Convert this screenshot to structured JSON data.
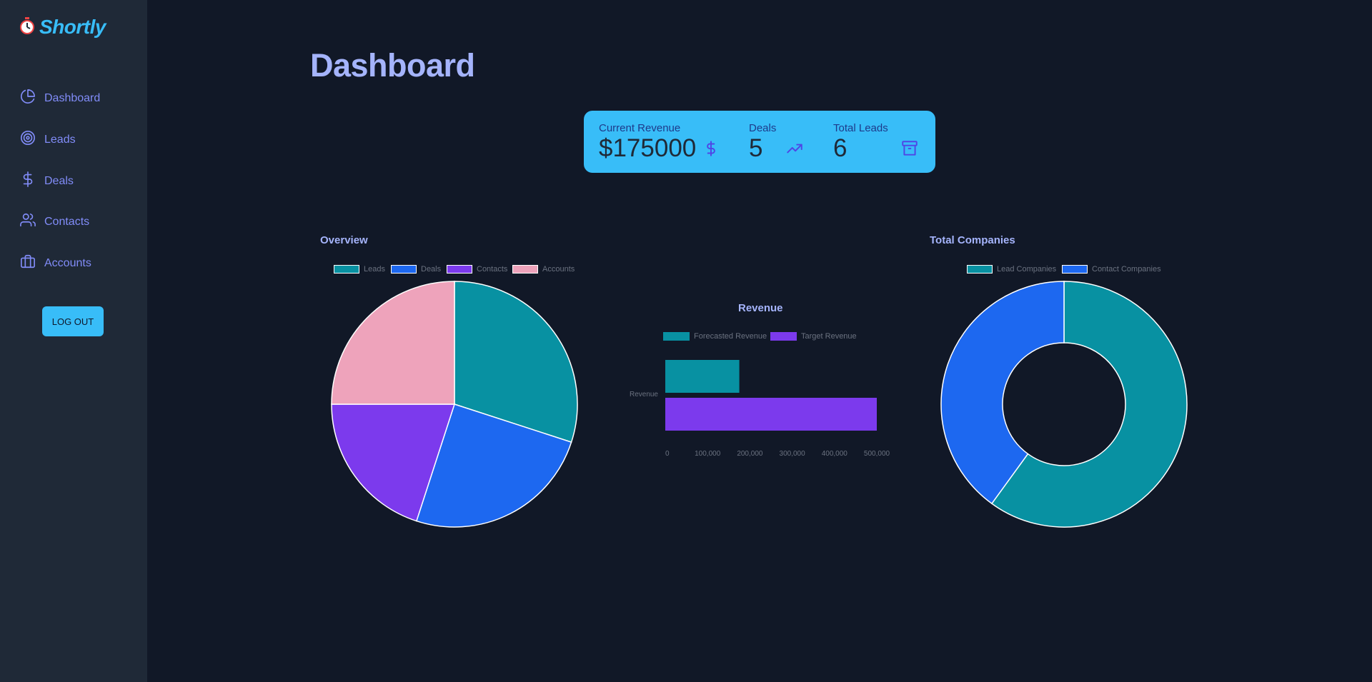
{
  "app": {
    "name": "Shortly"
  },
  "sidebar": {
    "items": [
      {
        "label": "Dashboard",
        "icon": "pie-chart-icon"
      },
      {
        "label": "Leads",
        "icon": "target-icon"
      },
      {
        "label": "Deals",
        "icon": "dollar-icon"
      },
      {
        "label": "Contacts",
        "icon": "users-icon"
      },
      {
        "label": "Accounts",
        "icon": "briefcase-icon"
      }
    ],
    "logout_label": "LOG OUT"
  },
  "page": {
    "title": "Dashboard"
  },
  "stats": {
    "revenue_label": "Current Revenue",
    "revenue_value": "$175000",
    "deals_label": "Deals",
    "deals_value": "5",
    "leads_label": "Total Leads",
    "leads_value": "6"
  },
  "colors": {
    "teal": "#0891a2",
    "blue": "#1d68f0",
    "purple": "#7c3aed",
    "pink": "#eea3bb",
    "accent": "#38bdf8"
  },
  "chart_data": [
    {
      "type": "pie",
      "title": "Overview",
      "categories": [
        "Leads",
        "Deals",
        "Contacts",
        "Accounts"
      ],
      "values": [
        6,
        5,
        4,
        5
      ],
      "legend": "top"
    },
    {
      "type": "bar",
      "title": "Revenue",
      "orientation": "horizontal",
      "categories": [
        "Revenue"
      ],
      "series": [
        {
          "name": "Forecasted Revenue",
          "values": [
            175000
          ]
        },
        {
          "name": "Target Revenue",
          "values": [
            500000
          ]
        }
      ],
      "xlim": [
        0,
        500000
      ],
      "xticks": [
        "0",
        "100,000",
        "200,000",
        "300,000",
        "400,000",
        "500,000"
      ],
      "legend": "top"
    },
    {
      "type": "pie",
      "subtype": "doughnut",
      "title": "Total Companies",
      "categories": [
        "Lead Companies",
        "Contact Companies"
      ],
      "values": [
        3,
        2
      ],
      "legend": "top"
    }
  ]
}
